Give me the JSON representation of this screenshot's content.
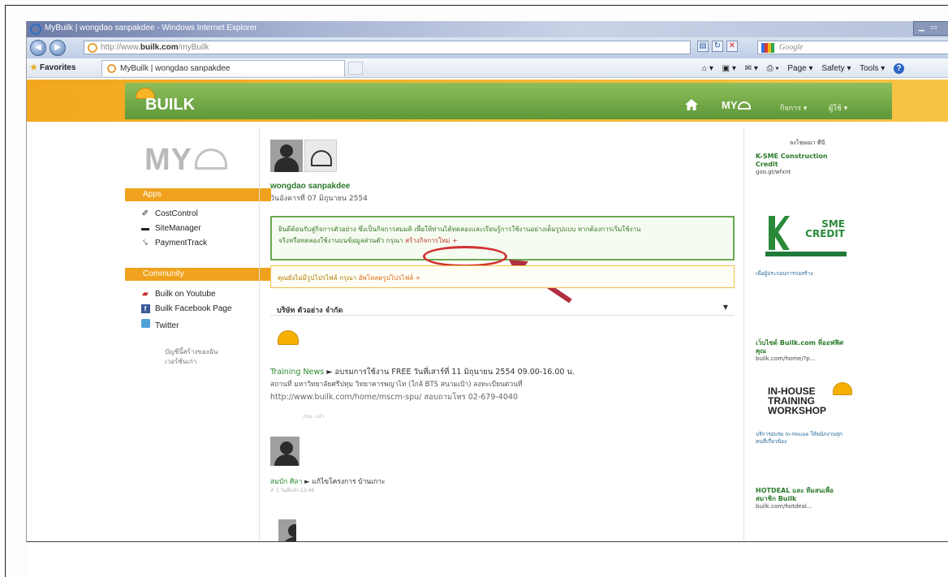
{
  "browser": {
    "window_title": "MyBuilk | wongdao sanpakdee - Windows Internet Explorer",
    "url_prefix": "http://www.",
    "url_domain": "builk.com",
    "url_path": "/myBuilk",
    "search_placeholder": "Google",
    "favorites_label": "Favorites",
    "tab_title": "MyBuilk | wongdao sanpakdee",
    "command_page": "Page ▾",
    "command_safety": "Safety ▾",
    "command_tools": "Tools ▾",
    "help_label": "?"
  },
  "site": {
    "logo_text": "BUILK",
    "nav_my": "MY",
    "nav_menu_1": "กิจการ ▾",
    "nav_menu_2": "ผู้ใช้ ▾"
  },
  "sidebar": {
    "my_logo": "MY",
    "apps_header": "Apps",
    "apps": [
      {
        "label": "CostControl",
        "icon": "✐"
      },
      {
        "label": "SiteManager",
        "icon": "▬"
      },
      {
        "label": "PaymentTrack",
        "icon": "⤥"
      }
    ],
    "community_header": "Community",
    "community": [
      {
        "label": "Builk on Youtube"
      },
      {
        "label": "Builk Facebook Page"
      },
      {
        "label": "Twitter"
      }
    ],
    "footer_line_1": "บัญชีนี้สร้างของฉัน",
    "footer_line_2": "เวอร์ชั่นเก่า"
  },
  "profile": {
    "name": "wongdao sanpakdee",
    "date": "วันอังคารที่ 07 มิถุนายน 2554"
  },
  "welcome": {
    "text_1": "ยินดีต้อนรับสู่กิจการตัวอย่าง ซึ่งเป็นกิจการสมมติ เพื่อให้ท่านได้ทดลองและเรียนรู้การใช้งานอย่างเต็มรูปแบบ หากต้องการเริ่มใช้งาน",
    "text_2": "จริงหรือทดลองใช้งานบนข้อมูลส่วนตัว กรุณา",
    "link": "สร้างกิจการใหม่ +"
  },
  "profile_note": {
    "text": "คุณยังไม่มีรูปโปรไฟล์ กรุณา",
    "link": "อัพโหลดรูปโปรไฟล์ +"
  },
  "company_selector": {
    "label": "บริษัท ตัวอย่าง จำกัด",
    "arrow": "▼"
  },
  "feed": {
    "post1_source": "Training News",
    "post1_title": "► อบรมการใช้งาน FREE วันที่เสาร์ที่ 11 มิถุนายน 2554 09.00-16.00 น.",
    "post1_line2": "สถานที่ มหาวิทยาลัยศรีปทุม วิทยาคารพญาไท (ใกล้ BTS สนามเป้า) ลงทะเบียนด่วนที่",
    "post1_line3": "http://www.builk.com/home/mscm-spu/ สอบถามโทร 02-679-4040",
    "post1_meta": "2ชม. แล้ว",
    "post2_user": "สมบัก ศิลา",
    "post2_action": "► แก้ไขโครงการ บ้านเกาะ",
    "post2_meta": "1 วันที่แล้ว 12:46"
  },
  "right": {
    "ad_title": "ลงโฆษณา ที่นี่",
    "ad1_head": "K-SME Construction Credit",
    "ad1_url": "goo.gl/wfxnt",
    "sme_text_1": "SME",
    "sme_text_2": "CREDIT",
    "ad1_body": "เพื่อผู้ประกอบการก่อสร้าง",
    "ad2_head": "เว็บไซต์ Builk.com ที่ออฟฟิศคุณ",
    "ad2_url": "builk.com/home/?p...",
    "inhouse_1": "IN-HOUSE",
    "inhouse_2": "TRAINING",
    "inhouse_3": "WORKSHOP",
    "ad2_body": "บริการอบรม In-House ให้พนักงานทุกคนที่เกี่ยวข้อง",
    "ad3_head": "HOTDEAL และ ทีมสนเพื่อสมาชิก Builk",
    "ad3_url": "builk.com/hotdeal..."
  }
}
